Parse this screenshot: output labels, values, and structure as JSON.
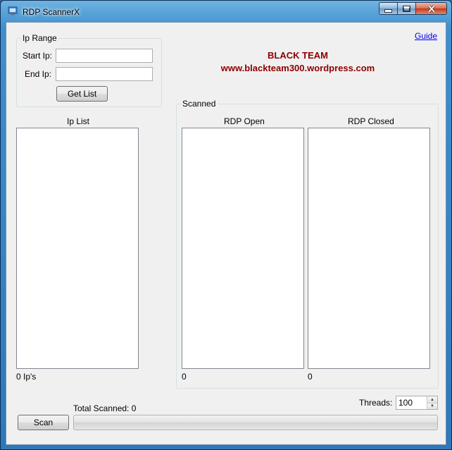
{
  "window": {
    "title": "RDP ScannerX"
  },
  "ip_range": {
    "group_label": "Ip Range",
    "start_label": "Start Ip:",
    "start_value": "",
    "end_label": "End Ip:",
    "end_value": "",
    "get_list_label": "Get List"
  },
  "guide_link": "Guide",
  "banner": {
    "line1": "BLACK TEAM",
    "line2": "www.blackteam300.wordpress.com"
  },
  "ip_list": {
    "header": "Ip List",
    "count_text": "0 Ip's"
  },
  "scanned": {
    "group_label": "Scanned",
    "open_header": "RDP Open",
    "open_count": "0",
    "closed_header": "RDP Closed",
    "closed_count": "0"
  },
  "threads": {
    "label": "Threads:",
    "value": "100"
  },
  "total_scanned": "Total Scanned: 0",
  "scan_label": "Scan",
  "progress": {
    "fraction": 0
  },
  "colors": {
    "banner": "#8b0000",
    "link": "#0000ee"
  }
}
